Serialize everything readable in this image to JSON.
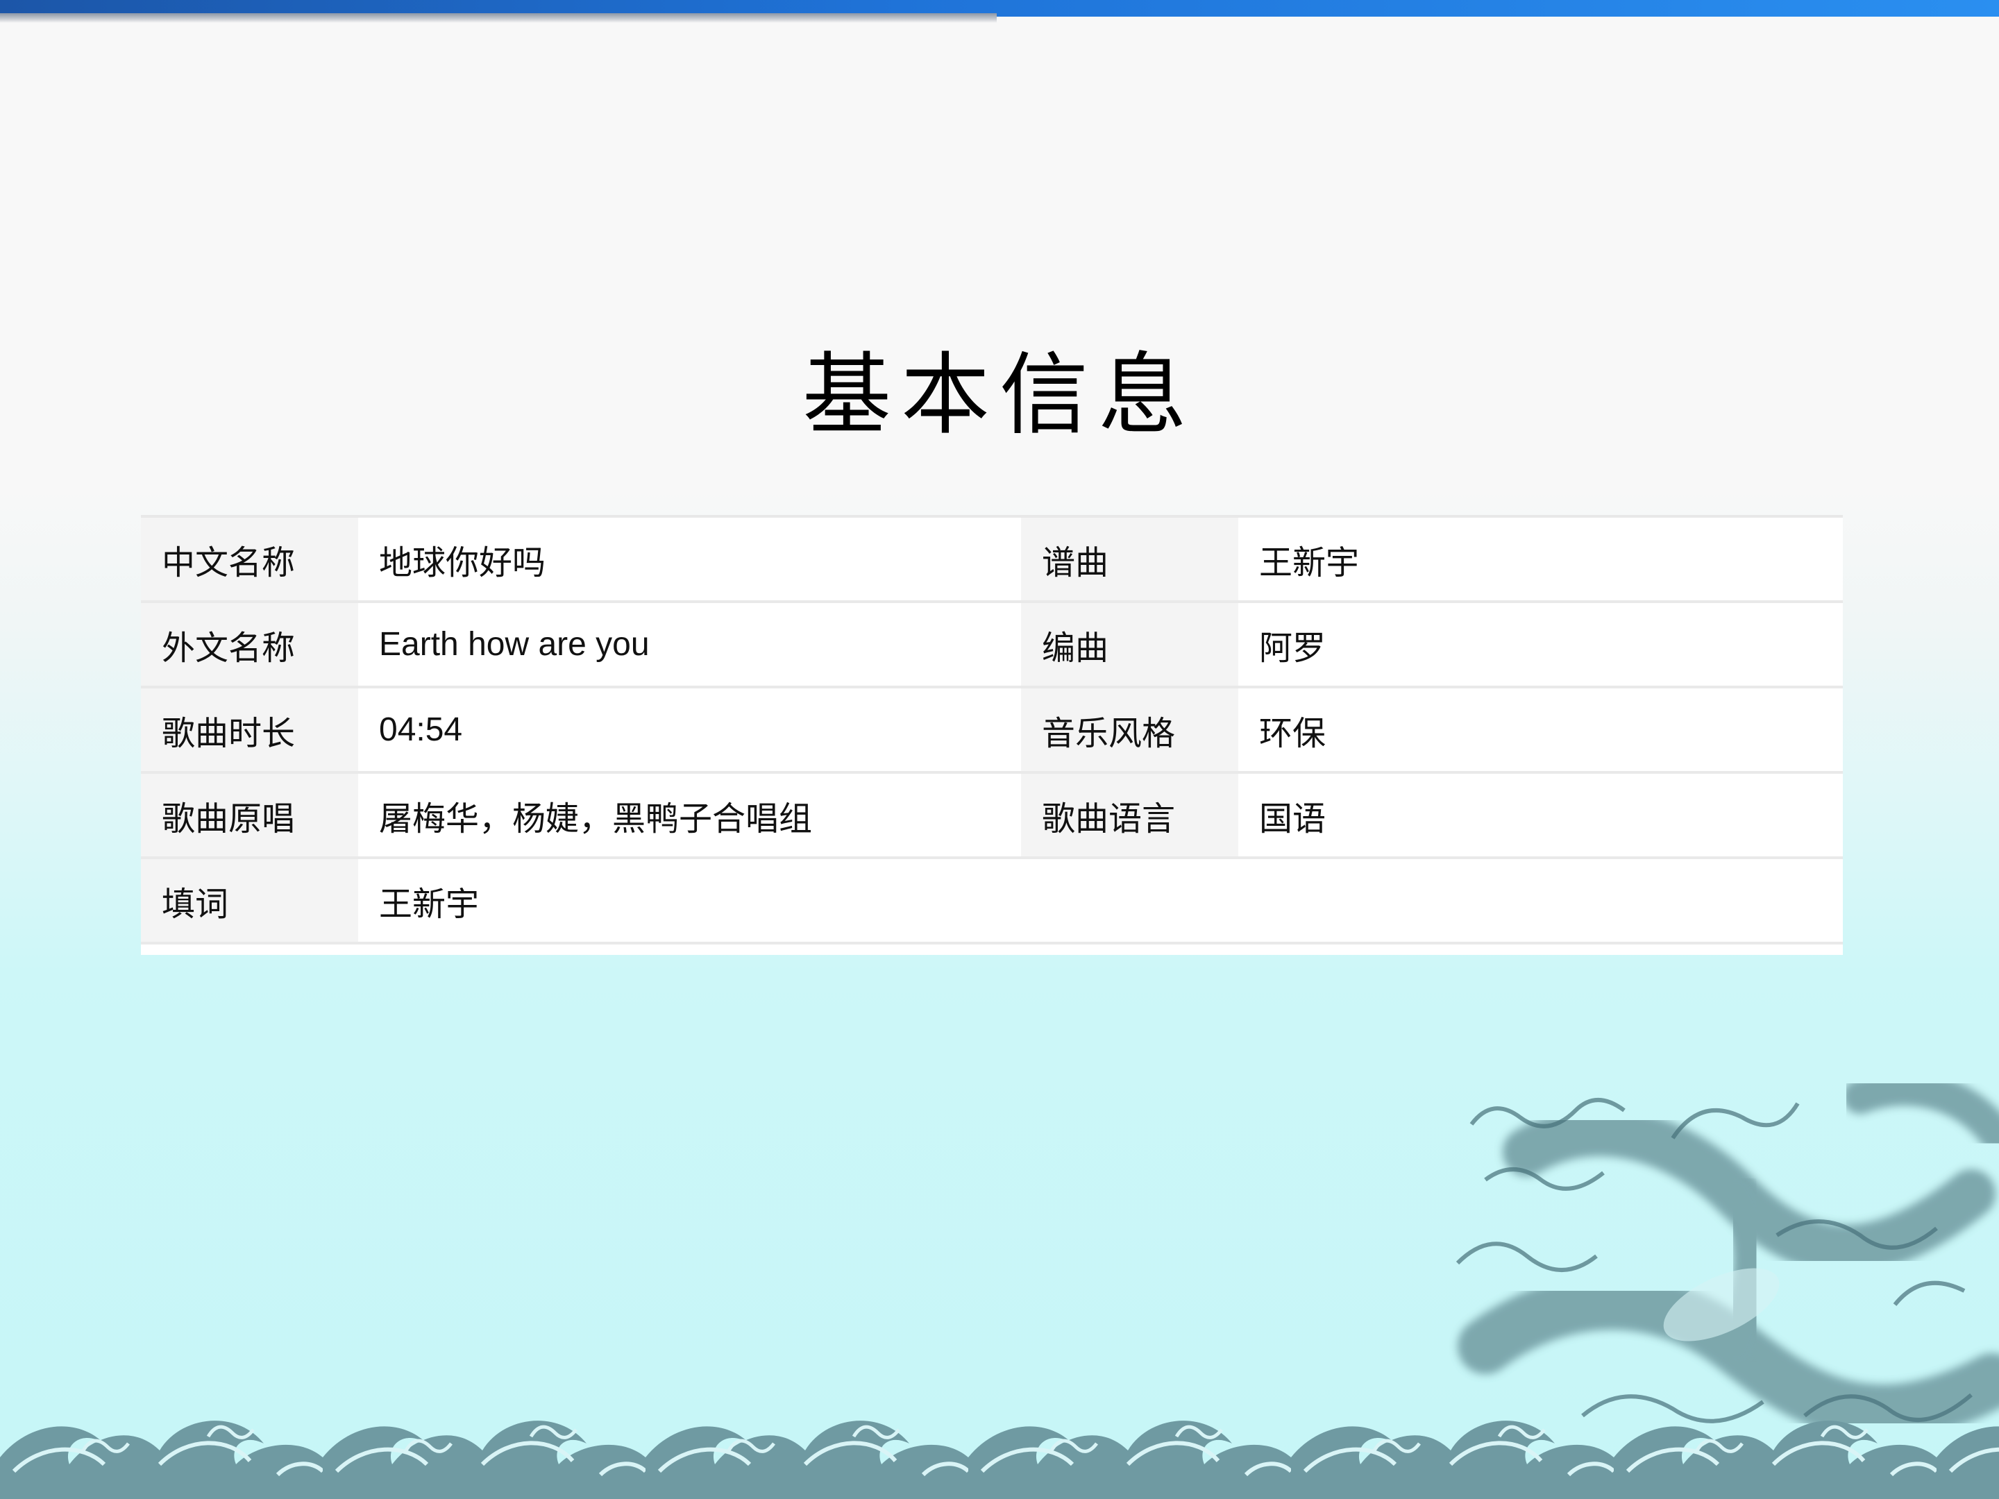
{
  "page": {
    "title": "基本信息"
  },
  "info": {
    "rows": [
      {
        "k1": "中文名称",
        "v1": "地球你好吗",
        "k2": "谱曲",
        "v2": "王新宇"
      },
      {
        "k1": "外文名称",
        "v1": "Earth how are you",
        "k2": "编曲",
        "v2": "阿罗"
      },
      {
        "k1": "歌曲时长",
        "v1": "04:54",
        "k2": "音乐风格",
        "v2": "环保"
      },
      {
        "k1": "歌曲原唱",
        "v1": "屠梅华，杨婕，黑鸭子合唱组",
        "k2": "歌曲语言",
        "v2": "国语"
      },
      {
        "k1": "填词",
        "v1": "王新宇",
        "k2": "",
        "v2": ""
      }
    ]
  },
  "decor": {
    "top_bar": "blue-gradient-bar",
    "waves": "wave-pattern-icon",
    "dragon": "dragon-icon"
  },
  "colors": {
    "top_bar": "#1f73d8",
    "background_bottom": "#c6f6f7",
    "wave": "#5f8e96"
  }
}
